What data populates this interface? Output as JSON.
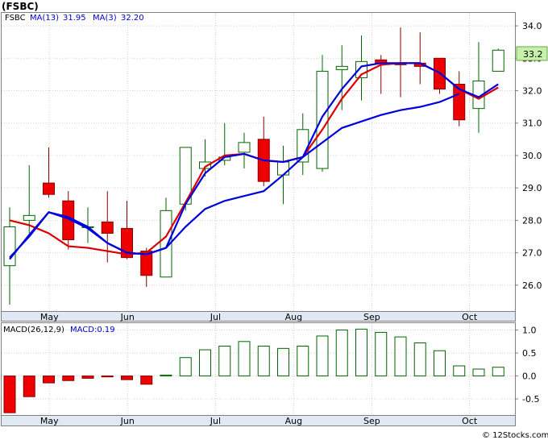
{
  "chart_data": [
    {
      "type": "candlestick",
      "title": "(FSBC)",
      "legend": [
        {
          "label": "FSBC",
          "color": "#000000"
        },
        {
          "label": "MA(13)",
          "value": "31.95",
          "color": "#0000cc"
        },
        {
          "label": "MA(3)",
          "value": "32.20",
          "color": "#0000cc"
        }
      ],
      "last_price_label": "33.2",
      "ylim": [
        25.2,
        34.4
      ],
      "yticks": [
        "26.0",
        "27.0",
        "28.0",
        "29.0",
        "30.0",
        "31.0",
        "32.0",
        "33.0",
        "34.0"
      ],
      "x_month_labels": [
        {
          "label": "May",
          "index": 1
        },
        {
          "label": "Jun",
          "index": 5
        },
        {
          "label": "Jul",
          "index": 9.5
        },
        {
          "label": "Aug",
          "index": 13.5
        },
        {
          "label": "Sep",
          "index": 17.5
        },
        {
          "label": "Oct",
          "index": 22.5
        }
      ],
      "candles": [
        {
          "open": 26.6,
          "high": 28.4,
          "low": 25.4,
          "close": 27.8
        },
        {
          "open": 28.0,
          "high": 29.7,
          "low": 27.6,
          "close": 28.15
        },
        {
          "open": 29.15,
          "high": 30.25,
          "low": 28.7,
          "close": 28.8
        },
        {
          "open": 28.6,
          "high": 28.9,
          "low": 27.1,
          "close": 27.4
        },
        {
          "open": 27.8,
          "high": 28.4,
          "low": 27.3,
          "close": 27.8
        },
        {
          "open": 27.95,
          "high": 28.9,
          "low": 26.7,
          "close": 27.6
        },
        {
          "open": 27.75,
          "high": 28.6,
          "low": 26.8,
          "close": 26.85
        },
        {
          "open": 27.05,
          "high": 27.15,
          "low": 25.95,
          "close": 26.3
        },
        {
          "open": 26.25,
          "high": 28.7,
          "low": 26.25,
          "close": 28.3
        },
        {
          "open": 28.5,
          "high": 30.25,
          "low": 28.3,
          "close": 30.25
        },
        {
          "open": 29.6,
          "high": 30.5,
          "low": 29.35,
          "close": 29.8
        },
        {
          "open": 29.85,
          "high": 31.0,
          "low": 29.7,
          "close": 29.95
        },
        {
          "open": 30.1,
          "high": 30.7,
          "low": 29.6,
          "close": 30.4
        },
        {
          "open": 30.5,
          "high": 31.2,
          "low": 29.05,
          "close": 29.2
        },
        {
          "open": 29.4,
          "high": 30.3,
          "low": 28.5,
          "close": 29.8
        },
        {
          "open": 29.8,
          "high": 31.3,
          "low": 29.4,
          "close": 30.8
        },
        {
          "open": 29.6,
          "high": 33.1,
          "low": 29.5,
          "close": 32.6
        },
        {
          "open": 32.65,
          "high": 33.4,
          "low": 31.4,
          "close": 32.75
        },
        {
          "open": 32.4,
          "high": 33.7,
          "low": 31.7,
          "close": 32.9
        },
        {
          "open": 32.95,
          "high": 33.1,
          "low": 31.9,
          "close": 32.85
        },
        {
          "open": 32.85,
          "high": 33.95,
          "low": 31.8,
          "close": 32.8
        },
        {
          "open": 32.85,
          "high": 33.8,
          "low": 32.2,
          "close": 32.75
        },
        {
          "open": 33.0,
          "high": 33.0,
          "low": 31.9,
          "close": 32.05
        },
        {
          "open": 32.2,
          "high": 32.6,
          "low": 30.9,
          "close": 31.1
        },
        {
          "open": 31.45,
          "high": 33.5,
          "low": 30.7,
          "close": 32.3
        },
        {
          "open": 32.6,
          "high": 33.3,
          "low": 32.6,
          "close": 33.25
        }
      ],
      "ma_red": [
        28.0,
        27.85,
        27.6,
        27.2,
        27.1,
        27.05,
        26.95,
        null,
        null,
        null,
        null,
        null,
        null,
        29.85,
        29.8,
        29.95,
        30.8,
        31.75,
        32.5,
        32.8,
        32.85,
        32.85,
        32.55,
        32.05,
        31.75,
        32.1
      ],
      "ma_blue": [
        26.8,
        27.55,
        28.25,
        28.1,
        null,
        null,
        null,
        26.95,
        27.1,
        27.8,
        28.4,
        28.6,
        28.8,
        29.4,
        29.95,
        30.55,
        31.0,
        31.25,
        31.4,
        31.55,
        31.7,
        31.9
      ],
      "ma_blue_start_index": 0,
      "ma_blue_points": [
        [
          0,
          26.8
        ],
        [
          1,
          27.55
        ],
        [
          2,
          28.25
        ],
        [
          3,
          28.1
        ],
        [
          4,
          27.8
        ],
        [
          5,
          27.3
        ],
        [
          6,
          27.0
        ],
        [
          7,
          26.95
        ],
        [
          8,
          27.15
        ],
        [
          9,
          27.8
        ],
        [
          10,
          28.35
        ],
        [
          11,
          28.6
        ],
        [
          12,
          28.75
        ],
        [
          13,
          28.9
        ],
        [
          14,
          29.4
        ],
        [
          15,
          29.95
        ],
        [
          16,
          30.4
        ],
        [
          17,
          30.85
        ],
        [
          18,
          31.05
        ],
        [
          19,
          31.25
        ],
        [
          20,
          31.4
        ],
        [
          21,
          31.5
        ],
        [
          22,
          31.65
        ],
        [
          23,
          31.9
        ]
      ],
      "ma_red_points": [
        [
          0,
          28.0
        ],
        [
          1,
          27.85
        ],
        [
          2,
          27.6
        ],
        [
          3,
          27.2
        ],
        [
          4,
          27.15
        ],
        [
          5,
          27.05
        ],
        [
          6,
          26.95
        ],
        [
          7,
          27.0
        ],
        [
          8,
          27.5
        ],
        [
          9,
          28.55
        ],
        [
          10,
          29.65
        ],
        [
          11,
          30.0
        ],
        [
          12,
          30.05
        ],
        [
          13,
          29.85
        ],
        [
          14,
          29.8
        ],
        [
          15,
          29.95
        ],
        [
          16,
          30.8
        ],
        [
          17,
          31.75
        ],
        [
          18,
          32.5
        ],
        [
          19,
          32.8
        ],
        [
          20,
          32.85
        ],
        [
          21,
          32.85
        ],
        [
          22,
          32.55
        ],
        [
          23,
          32.05
        ],
        [
          24,
          31.75
        ],
        [
          25,
          32.1
        ]
      ],
      "ma_blue_fast_points": [
        [
          0,
          26.85
        ],
        [
          1,
          27.5
        ],
        [
          2,
          28.25
        ],
        [
          3,
          28.05
        ],
        [
          4,
          27.75
        ],
        [
          5,
          27.3
        ],
        [
          6,
          27.0
        ],
        [
          7,
          26.95
        ],
        [
          8,
          27.15
        ],
        [
          9,
          28.5
        ],
        [
          10,
          29.45
        ],
        [
          11,
          29.95
        ],
        [
          12,
          30.05
        ],
        [
          13,
          29.85
        ],
        [
          14,
          29.8
        ],
        [
          15,
          29.95
        ],
        [
          16,
          31.2
        ],
        [
          17,
          32.05
        ],
        [
          18,
          32.75
        ],
        [
          19,
          32.85
        ],
        [
          20,
          32.85
        ],
        [
          21,
          32.85
        ],
        [
          22,
          32.55
        ],
        [
          23,
          32.05
        ],
        [
          24,
          31.8
        ],
        [
          25,
          32.2
        ]
      ]
    },
    {
      "type": "bar",
      "title": "MACD(26,12,9)",
      "legend": [
        {
          "label": "MACD(26,12,9)",
          "color": "#000000"
        },
        {
          "label": "MACD:0.19",
          "color": "#0000cc"
        }
      ],
      "ylim": [
        -0.85,
        1.15
      ],
      "yticks": [
        "1.0",
        "0.5",
        "0.0",
        "-0.5"
      ],
      "values": [
        -0.8,
        -0.45,
        -0.15,
        -0.1,
        -0.05,
        -0.02,
        -0.08,
        -0.18,
        0.02,
        0.4,
        0.57,
        0.65,
        0.75,
        0.65,
        0.6,
        0.65,
        0.87,
        1.0,
        1.02,
        0.95,
        0.85,
        0.72,
        0.55,
        0.22,
        0.15,
        0.19
      ]
    }
  ],
  "x_month_labels": [
    "May",
    "Jun",
    "Jul",
    "Aug",
    "Sep",
    "Oct"
  ],
  "watermark": "© 12Stocks.com"
}
